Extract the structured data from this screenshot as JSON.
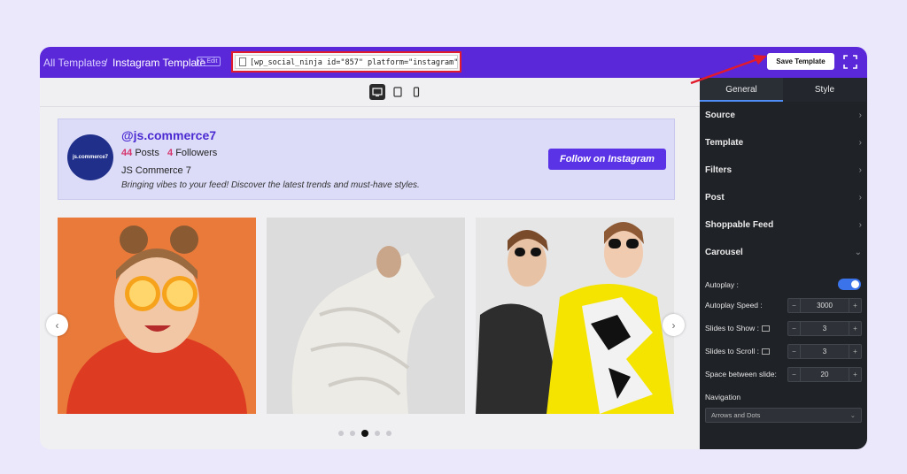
{
  "topbar": {
    "crumb_all": "All Templates",
    "crumb_sep": "/",
    "crumb_current": "Instagram Template",
    "edit_label": "Edit",
    "shortcode": "[wp_social_ninja id=\"857\" platform=\"instagram\"]",
    "save_label": "Save Template"
  },
  "devices": [
    "desktop-icon",
    "tablet-icon",
    "mobile-icon"
  ],
  "profile": {
    "avatar_text": "js.commerce7",
    "handle": "@js.commerce7",
    "posts_count": "44",
    "posts_label": "Posts",
    "followers_count": "4",
    "followers_label": "Followers",
    "name": "JS Commerce 7",
    "bio": "Bringing vibes to your feed! Discover the latest trends and must-have styles.",
    "follow_label": "Follow on Instagram"
  },
  "carousel": {
    "prev_icon": "chevron-left-icon",
    "next_icon": "chevron-right-icon",
    "active_dot": 3,
    "dot_count": 5
  },
  "panel": {
    "tabs": [
      "General",
      "Style"
    ],
    "sections": [
      "Source",
      "Template",
      "Filters",
      "Post",
      "Shoppable Feed",
      "Carousel"
    ],
    "autoplay_label": "Autoplay :",
    "autoplay_speed_label": "Autoplay Speed :",
    "autoplay_speed": "3000",
    "slides_show_label": "Slides to Show :",
    "slides_show": "3",
    "slides_scroll_label": "Slides to Scroll :",
    "slides_scroll": "3",
    "space_label": "Space between slide:",
    "space": "20",
    "navigation_label": "Navigation",
    "navigation_value": "Arrows and Dots"
  },
  "colors": {
    "topbar": "#5a27d9",
    "highlight_red": "#e21b2c",
    "follow_button": "#5a33e6",
    "panel_bg": "#1f2227",
    "toggle_on": "#3b73ea"
  }
}
